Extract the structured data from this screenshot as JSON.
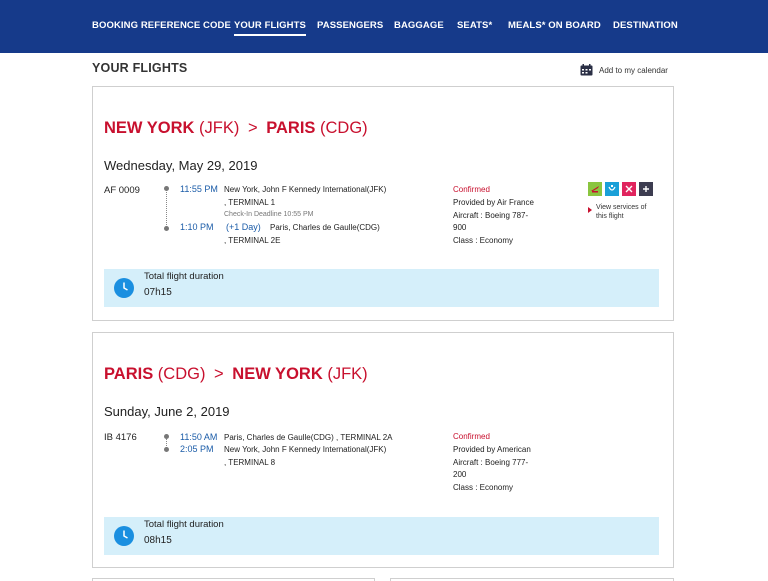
{
  "nav": {
    "items": [
      {
        "label": "BOOKING REFERENCE CODE"
      },
      {
        "label": "YOUR FLIGHTS"
      },
      {
        "label": "PASSENGERS"
      },
      {
        "label": "BAGGAGE"
      },
      {
        "label": "SEATS*"
      },
      {
        "label": "MEALS* ON BOARD"
      },
      {
        "label": "DESTINATION"
      }
    ],
    "active": "YOUR FLIGHTS"
  },
  "page": {
    "title": "YOUR FLIGHTS",
    "calendar_label": "Add to my calendar"
  },
  "colors": {
    "nav_bg": "#163a8a",
    "route_red": "#c8102e",
    "time_blue": "#1b5ca8",
    "duration_bg": "#d5effa"
  },
  "flights": [
    {
      "from_city": "NEW YORK",
      "from_code": "(JFK)",
      "arrow": ">",
      "to_city": "PARIS",
      "to_code": "(CDG)",
      "date": "Wednesday, May 29, 2019",
      "flight_number": "AF 0009",
      "departure_time": "11:55 PM",
      "departure_place": "New York, John F Kennedy International(JFK)",
      "departure_terminal": ", TERMINAL 1",
      "checkin_deadline": "Check-In Deadline 10:55 PM",
      "arrival_time": "1:10 PM",
      "arrival_plus_day": "(+1 Day)",
      "arrival_place": "Paris, Charles de Gaulle(CDG)",
      "arrival_terminal": ", TERMINAL 2E",
      "status": "Confirmed",
      "provider": "Provided by Air France",
      "aircraft_line1": "Aircraft : Boeing 787-",
      "aircraft_line2": "900",
      "class": "Class : Economy",
      "services": [
        {
          "icon": "seat-icon",
          "color": "#8ac53f",
          "glyph": "✈"
        },
        {
          "icon": "baggage-icon",
          "color": "#1aa0d8",
          "glyph": "⟟"
        },
        {
          "icon": "meal-icon",
          "color": "#e0245e",
          "glyph": "✚"
        },
        {
          "icon": "more-services-icon",
          "color": "#3c3c50",
          "glyph": "+"
        }
      ],
      "view_services_line1": "View services of",
      "view_services_line2": "this flight",
      "duration_label": "Total flight duration",
      "duration_value": "07h15"
    },
    {
      "from_city": "PARIS",
      "from_code": "(CDG)",
      "arrow": ">",
      "to_city": "NEW YORK",
      "to_code": "(JFK)",
      "date": "Sunday, June 2, 2019",
      "flight_number": "IB 4176",
      "departure_time": "11:50 AM",
      "departure_place": "Paris, Charles de Gaulle(CDG) , TERMINAL 2A",
      "arrival_time": "2:05 PM",
      "arrival_place": "New York, John F Kennedy International(JFK)",
      "arrival_terminal": ", TERMINAL 8",
      "status": "Confirmed",
      "provider": "Provided by American",
      "aircraft_line1": "Aircraft : Boeing 777-",
      "aircraft_line2": "200",
      "class": "Class : Economy",
      "duration_label": "Total flight duration",
      "duration_value": "08h15"
    }
  ]
}
